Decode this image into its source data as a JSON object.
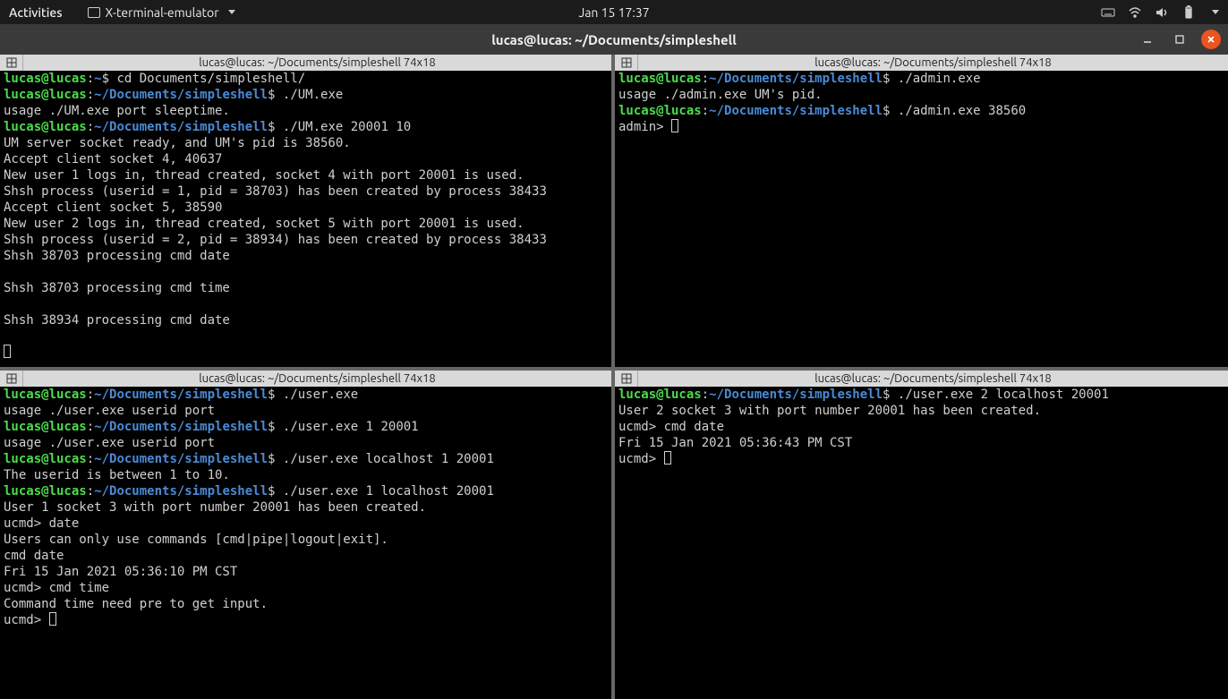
{
  "topbar": {
    "activities": "Activities",
    "app_menu": "X-terminal-emulator",
    "clock": "Jan 15  17:37"
  },
  "window": {
    "title": "lucas@lucas: ~/Documents/simpleshell"
  },
  "prompt": {
    "user_host": "lucas@lucas",
    "sep": ":",
    "home_path": "~",
    "doc_path": "~/Documents/simpleshell",
    "sigil": "$ "
  },
  "panes": {
    "tl": {
      "title": "lucas@lucas: ~/Documents/simpleshell 74x18",
      "cmd_cd": "cd Documents/simpleshell/",
      "cmd_um1": "./UM.exe",
      "out_um_usage": "usage ./UM.exe port sleeptime.",
      "cmd_um2": "./UM.exe 20001 10",
      "out1": "UM server socket ready, and UM's pid is 38560.",
      "out2": "Accept client socket 4, 40637",
      "out3": "New user 1 logs in, thread created, socket 4 with port 20001 is used.",
      "out4": "Shsh process (userid = 1, pid = 38703) has been created by process 38433",
      "out5": "Accept client socket 5, 38590",
      "out6": "New user 2 logs in, thread created, socket 5 with port 20001 is used.",
      "out7": "Shsh process (userid = 2, pid = 38934) has been created by process 38433",
      "out8": "Shsh 38703 processing cmd date",
      "out9": "Shsh 38703 processing cmd time",
      "out10": "Shsh 38934 processing cmd date"
    },
    "tr": {
      "title": "lucas@lucas: ~/Documents/simpleshell 74x18",
      "cmd_admin1": "./admin.exe",
      "out_admin_usage": "usage ./admin.exe UM's pid.",
      "cmd_admin2": "./admin.exe 38560",
      "prompt2": "admin> "
    },
    "bl": {
      "title": "lucas@lucas: ~/Documents/simpleshell 74x18",
      "cmd_u1": "./user.exe",
      "out_u_usage": "usage ./user.exe userid port",
      "cmd_u2": "./user.exe 1 20001",
      "out_u_usage2": "usage ./user.exe userid port",
      "cmd_u3": "./user.exe localhost 1 20001",
      "out_range": "The userid is between 1 to 10.",
      "cmd_u4": "./user.exe 1 localhost 20001",
      "out_sock": "User 1 socket 3 with port number 20001 has been created.",
      "ucmd1": "ucmd> date",
      "out_only": "Users can only use commands [cmd|pipe|logout|exit].",
      "ucmd2": "cmd date",
      "out_date": "Fri 15 Jan 2021 05:36:10 PM CST",
      "ucmd3": "ucmd> cmd time",
      "out_time_err": "Command time need pre to get input.",
      "ucmd4": "ucmd> "
    },
    "br": {
      "title": "lucas@lucas: ~/Documents/simpleshell 74x18",
      "cmd_u1": "./user.exe 2 localhost 20001",
      "out_sock": "User 2 socket 3 with port number 20001 has been created.",
      "ucmd1": "ucmd> cmd date",
      "out_date": "Fri 15 Jan 2021 05:36:43 PM CST",
      "ucmd2": "ucmd> "
    }
  }
}
